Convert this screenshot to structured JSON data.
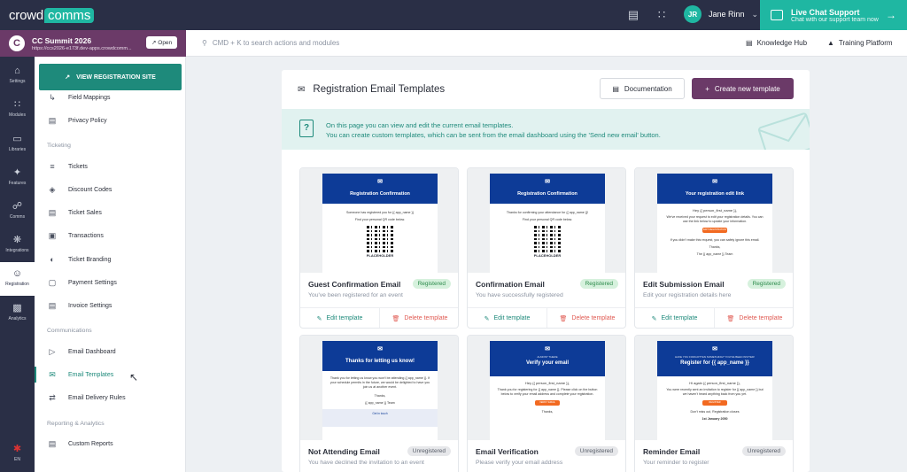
{
  "topbar": {
    "logo_text": "crowd",
    "logo_pill": "comms",
    "user_initials": "JR",
    "user_name": "Jane Rinn",
    "chat_title": "Live Chat Support",
    "chat_subtitle": "Chat with our support team now"
  },
  "event": {
    "title": "CC Summit 2026",
    "url": "https://ccs2026-e173f.dev-apps.crowdcomm...",
    "open_label": "Open"
  },
  "search": {
    "placeholder": "CMD + K to search actions and modules"
  },
  "links": {
    "knowledge": "Knowledge Hub",
    "training": "Training Platform"
  },
  "rail": [
    {
      "label": "Settings",
      "icon": "home-icon"
    },
    {
      "label": "Modules",
      "icon": "grid-icon"
    },
    {
      "label": "Libraries",
      "icon": "folder-icon"
    },
    {
      "label": "Features",
      "icon": "sparkle-icon"
    },
    {
      "label": "Comms",
      "icon": "comms-icon"
    },
    {
      "label": "Integrations",
      "icon": "puzzle-icon"
    },
    {
      "label": "Registration",
      "icon": "registration-icon"
    },
    {
      "label": "Analytics",
      "icon": "analytics-icon"
    }
  ],
  "lang": "EN",
  "sidebar": {
    "view_site": "VIEW REGISTRATION SITE",
    "items": [
      "Field Mappings",
      "Privacy Policy",
      "Tickets",
      "Discount Codes",
      "Ticket Sales",
      "Transactions",
      "Ticket Branding",
      "Payment Settings",
      "Invoice Settings",
      "Email Dashboard",
      "Email Templates",
      "Email Delivery Rules",
      "Custom Reports"
    ],
    "headings": [
      "Ticketing",
      "Communications",
      "Reporting & Analytics"
    ]
  },
  "main": {
    "title": "Registration Email Templates",
    "doc_label": "Documentation",
    "new_label": "Create new template",
    "info1": "On this page you can view and edit the current email templates.",
    "info2": "You can create custom templates, which can be sent from the email dashboard using the 'Send new email' button."
  },
  "cards": [
    {
      "name": "Guest Confirmation Email",
      "desc": "You've been registered for an event",
      "status": "Registered",
      "preview_title": "Registration Confirmation",
      "preview_line1": "Someone has registered you for {{ app_name }}",
      "preview_line2": "Find your personal QR code below.",
      "qr_label": "PLACEHOLDER"
    },
    {
      "name": "Confirmation Email",
      "desc": "You have successfully registered",
      "status": "Registered",
      "preview_title": "Registration Confirmation",
      "preview_line1": "Thanks for confirming your attendance for {{ app_name }}!",
      "preview_line2": "Find your personal QR code below.",
      "qr_label": "PLACEHOLDER"
    },
    {
      "name": "Edit Submission Email",
      "desc": "Edit your registration details here",
      "status": "Registered",
      "preview_title": "Your registration edit link",
      "preview_line1": "Hey {{ person_first_name }},",
      "preview_line2": "We've received your request to edit your registration details. You can use the link below to update your information.",
      "preview_btn": "EDIT REGISTRATION",
      "preview_line3": "If you didn't make this request, you can safely ignore this email.",
      "preview_line4": "Thanks,",
      "preview_line5": "The {{ app_name }} Team"
    },
    {
      "name": "Not Attending Email",
      "desc": "You have declined the invitation to an event",
      "status": "Unregistered",
      "preview_title": "Thanks for letting us know!",
      "preview_line1": "Thank you for letting us know you won't be attending {{ app_name }}. If your schedule permits in the future, we would be delighted to have you join us at another event.",
      "preview_line2": "Thanks,",
      "preview_line3": "{{ app_name }} Team",
      "preview_foot": "Get in touch"
    },
    {
      "name": "Email Verification",
      "desc": "Please verify your email address",
      "status": "Unregistered",
      "preview_small": "ALMOST THERE",
      "preview_title": "Verify your email",
      "preview_line1": "Hey {{ person_first_name }},",
      "preview_line2": "Thank you for registering for {{ app_name }}. Please click on the button below to verify your email address and complete your registration.",
      "preview_btn": "VERIFY EMAIL",
      "preview_line3": "Thanks,"
    },
    {
      "name": "Reminder Email",
      "desc": "Your reminder to register",
      "status": "Unregistered",
      "preview_small": "HAVE YOU FORGOTTEN SOMETHING? YOU'VE BEEN INVITED!",
      "preview_title": "Register for {{ app_name }}",
      "preview_line1": "Hi again {{ person_first_name }},",
      "preview_line2": "You were recently sent an invitation to register for {{ app_name }} but we haven't heard anything back from you yet.",
      "preview_btn": "REGISTER",
      "preview_line3": "Don't miss out, Registration closes",
      "preview_line4": "1st January 2050"
    }
  ],
  "card_actions": {
    "edit": "Edit template",
    "delete": "Delete template"
  }
}
